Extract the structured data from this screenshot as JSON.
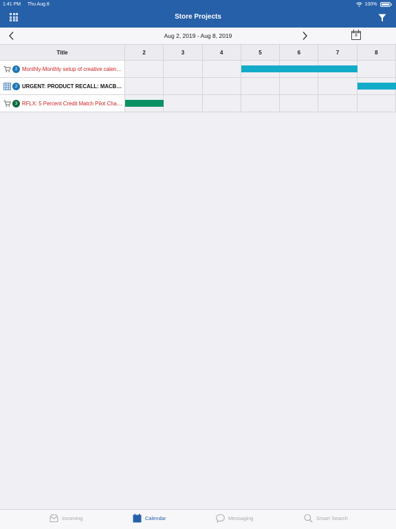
{
  "status_bar": {
    "time": "1:41 PM",
    "date": "Thu Aug 8",
    "battery": "100%"
  },
  "app": {
    "title": "Store Projects"
  },
  "date_nav": {
    "range": "Aug 2, 2019 - Aug 8, 2019",
    "calendar_day": "8"
  },
  "grid": {
    "title_header": "Title",
    "days": [
      "2",
      "3",
      "4",
      "5",
      "6",
      "7",
      "8"
    ],
    "rows": [
      {
        "badge": "2",
        "text": "Monthly-Monthly setup of creative calenda...",
        "icon": "cart-icon",
        "text_color": "#cc2222",
        "badge_color": "#1c76b6",
        "bar_color": "#12acc8",
        "bar_start_day": "5",
        "bar_end_day": "7"
      },
      {
        "badge": "2",
        "text": "URGENT: PRODUCT RECALL: MACBOOK...",
        "icon": "grid-list-icon",
        "text_color": "#111111",
        "badge_color": "#1c76b6",
        "bar_color": "#12acc8",
        "bar_start_day": "8",
        "bar_end_day": "8"
      },
      {
        "badge": "3",
        "text": "RFLX: 5 Percent Credit Match Pilot Change...",
        "icon": "cart-icon",
        "text_color": "#cc2222",
        "badge_color": "#0f6a3f",
        "bar_color": "#0b9162",
        "bar_start_day": "2",
        "bar_end_day": "2"
      }
    ]
  },
  "tabs": [
    {
      "label": "Incoming",
      "icon": "inbox-icon",
      "active": false
    },
    {
      "label": "Calendar",
      "icon": "calendar-icon",
      "active": true
    },
    {
      "label": "Messaging",
      "icon": "chat-bubble-icon",
      "active": false
    },
    {
      "label": "Smart Search",
      "icon": "search-icon",
      "active": false
    }
  ],
  "colors": {
    "header_blue": "#2660a8",
    "active_tab": "#2660a8",
    "inactive_tab": "#a9a9b0"
  }
}
